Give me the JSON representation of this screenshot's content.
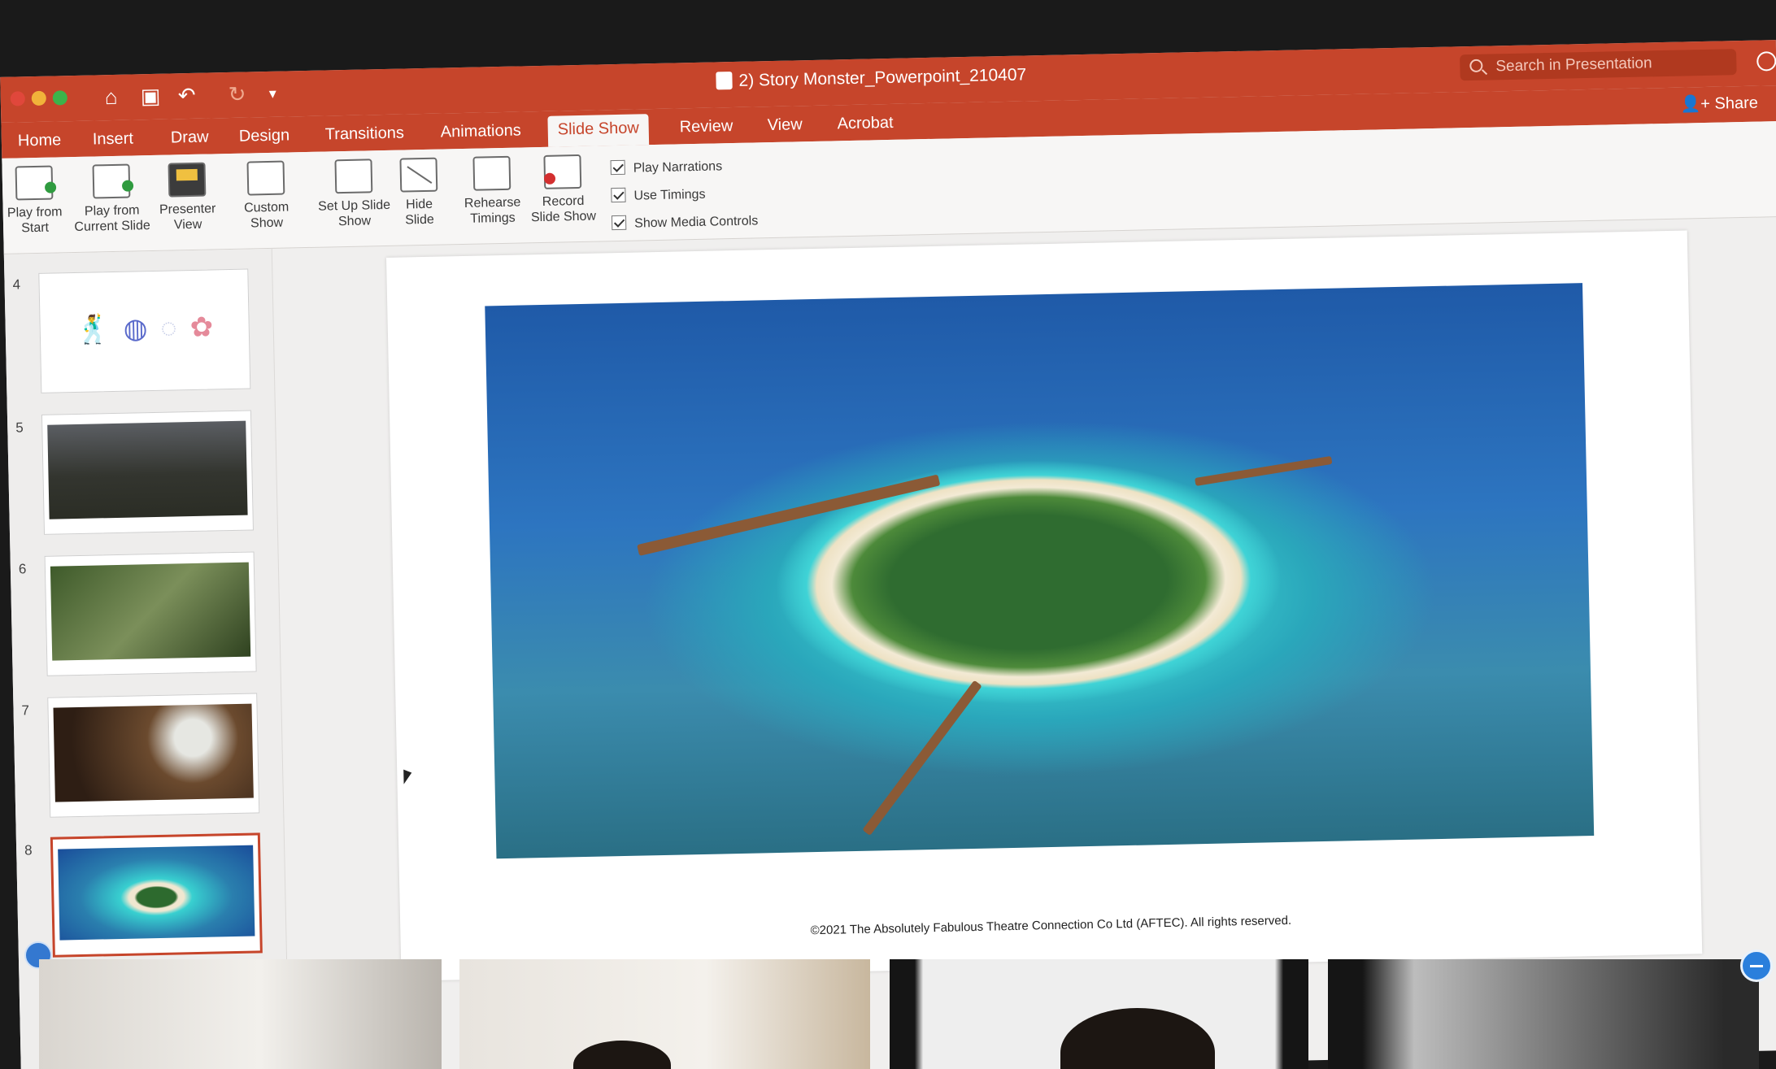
{
  "window": {
    "title": "2) Story Monster_Powerpoint_210407",
    "search_placeholder": "Search in Presentation",
    "share_label": "Share"
  },
  "tabs": [
    {
      "label": "Home"
    },
    {
      "label": "Insert"
    },
    {
      "label": "Draw"
    },
    {
      "label": "Design"
    },
    {
      "label": "Transitions"
    },
    {
      "label": "Animations"
    },
    {
      "label": "Slide Show",
      "active": true
    },
    {
      "label": "Review"
    },
    {
      "label": "View"
    },
    {
      "label": "Acrobat"
    }
  ],
  "ribbon": {
    "play_from_start": "Play from Start",
    "play_from_current": "Play from Current Slide",
    "presenter_view": "Presenter View",
    "custom_show": "Custom Show",
    "set_up": "Set Up Slide Show",
    "hide_slide": "Hide Slide",
    "rehearse": "Rehearse Timings",
    "record": "Record Slide Show",
    "play_narrations": "Play Narrations",
    "use_timings": "Use Timings",
    "show_media_controls": "Show Media Controls"
  },
  "thumbnails": [
    {
      "number": "4"
    },
    {
      "number": "5"
    },
    {
      "number": "6"
    },
    {
      "number": "7"
    },
    {
      "number": "8",
      "selected": true
    }
  ],
  "slide": {
    "copyright": "©2021 The Absolutely Fabulous Theatre Connection Co Ltd (AFTEC). All rights reserved."
  },
  "colors": {
    "accent": "#c6452b",
    "ribbon_bg": "#f7f6f5"
  }
}
